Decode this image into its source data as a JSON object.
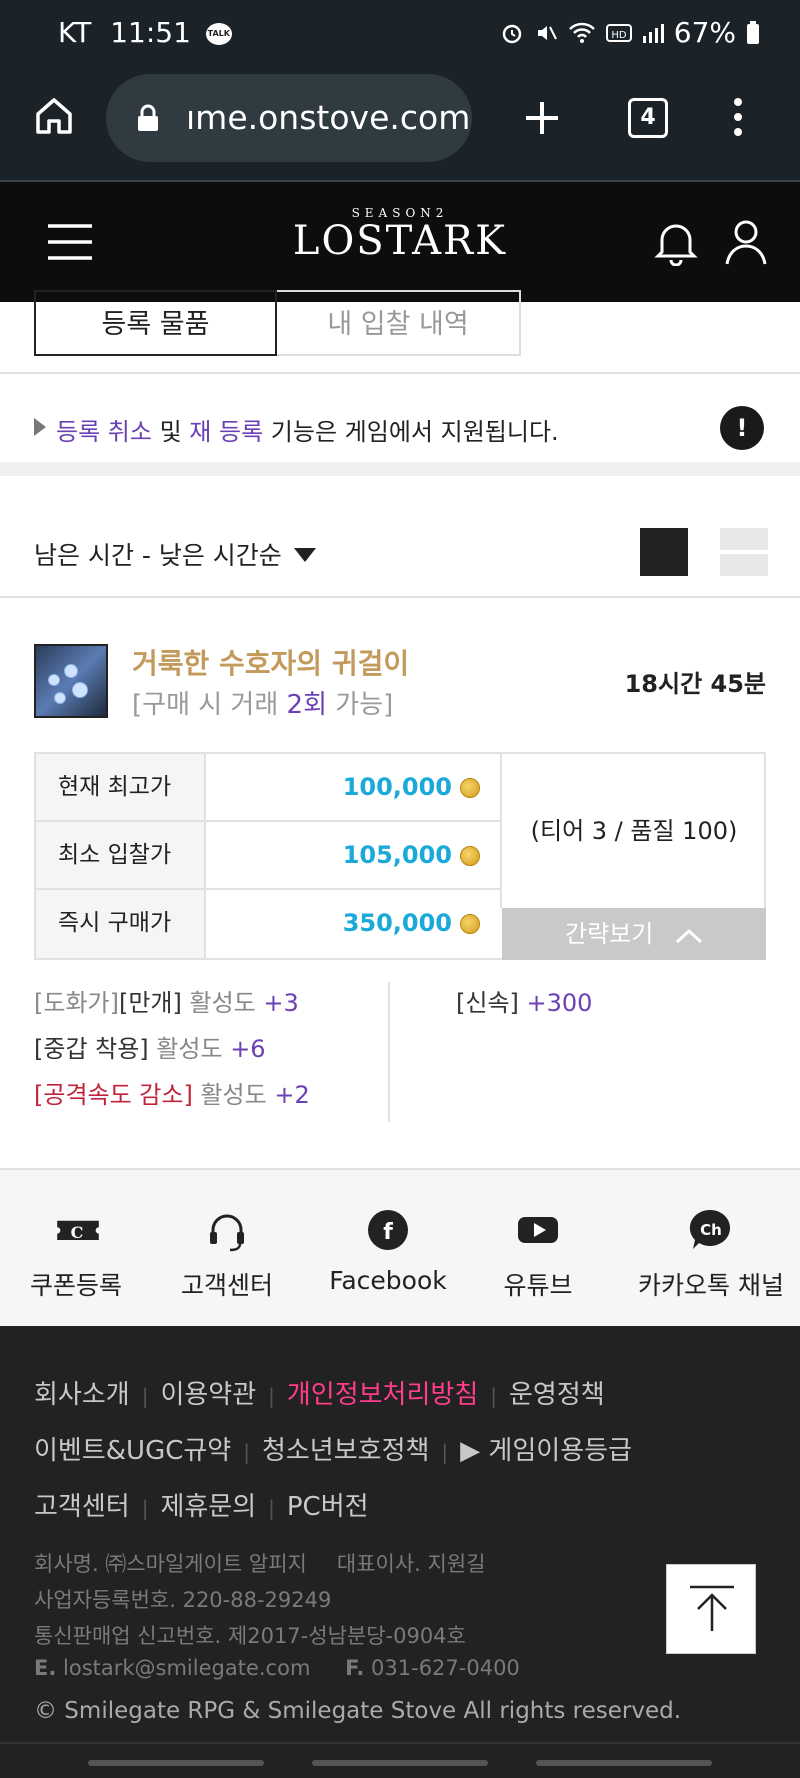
{
  "status_bar": {
    "carrier": "KT",
    "time": "11:51",
    "talk_badge": "TALK",
    "battery": "67%"
  },
  "browser": {
    "url": "ıme.onstove.com",
    "tab_count": "4"
  },
  "site": {
    "season_label": "SEASON2",
    "logo_text": "LOSTARK"
  },
  "tabs": [
    {
      "label": "등록 물품"
    },
    {
      "label": "내 입찰 내역"
    }
  ],
  "notice": {
    "part1": "등록 취소",
    "part2": " 및 ",
    "part3": "재 등록",
    "part4": " 기능은 게임에서 지원됩니다.",
    "icon_text": "!"
  },
  "sort": {
    "label": "남은 시간 - 낮은 시간순"
  },
  "item": {
    "name": "거룩한 수호자의 귀걸이",
    "trade_prefix": "[구매 시 거래 ",
    "trade_count": "2회",
    "trade_suffix": " 가능]",
    "time_left": "18시간 45분",
    "prices": [
      {
        "label": "현재 최고가",
        "value": "100,000"
      },
      {
        "label": "최소 입찰가",
        "value": "105,000"
      },
      {
        "label": "즉시 구매가",
        "value": "350,000"
      }
    ],
    "tier_quality": "(티어 3 / 품질 100)",
    "brief_label": "간략보기",
    "engravings": [
      {
        "name_a": "[도화가]",
        "name_b": "[만개]",
        "label": " 활성도 ",
        "value": "+3"
      },
      {
        "name": "[중갑 착용]",
        "label": " 활성도 ",
        "value": "+6"
      },
      {
        "name": "[공격속도 감소]",
        "label": " 활성도 ",
        "value": "+2"
      }
    ],
    "stat": {
      "name": "[신속]",
      "value": " +300"
    }
  },
  "quick_links": [
    {
      "label": "쿠폰등록",
      "icon": "coupon-icon"
    },
    {
      "label": "고객센터",
      "icon": "headset-icon"
    },
    {
      "label": "Facebook",
      "icon": "facebook-icon"
    },
    {
      "label": "유튜브",
      "icon": "youtube-icon"
    },
    {
      "label": "카카오톡 채널",
      "icon": "kakao-channel-icon"
    }
  ],
  "footer": {
    "links_row1": [
      "회사소개",
      "이용약관",
      "개인정보처리방침",
      "운영정책"
    ],
    "links_row2": [
      "이벤트&UGC규약",
      "청소년보호정책",
      "▶ 게임이용등급"
    ],
    "links_row3": [
      "고객센터",
      "제휴문의",
      "PC버전"
    ],
    "company": "회사명. ㈜스마일게이트 알피지",
    "ceo": "대표이사. 지원길",
    "biz_no": "사업자등록번호. 220-88-29249",
    "mail_order": "통신판매업 신고번호. 제2017-성남분당-0904호",
    "email_label": "E.",
    "email": "lostark@smilegate.com",
    "fax_label": "F.",
    "fax": "031-627-0400",
    "copyright": "© Smilegate RPG & Smilegate Stove All rights reserved."
  },
  "colors": {
    "accent_purple": "#6b40b4",
    "price_blue": "#1aa9d8",
    "item_gold": "#c29a5b",
    "footer_pink": "#ff3d8b"
  }
}
